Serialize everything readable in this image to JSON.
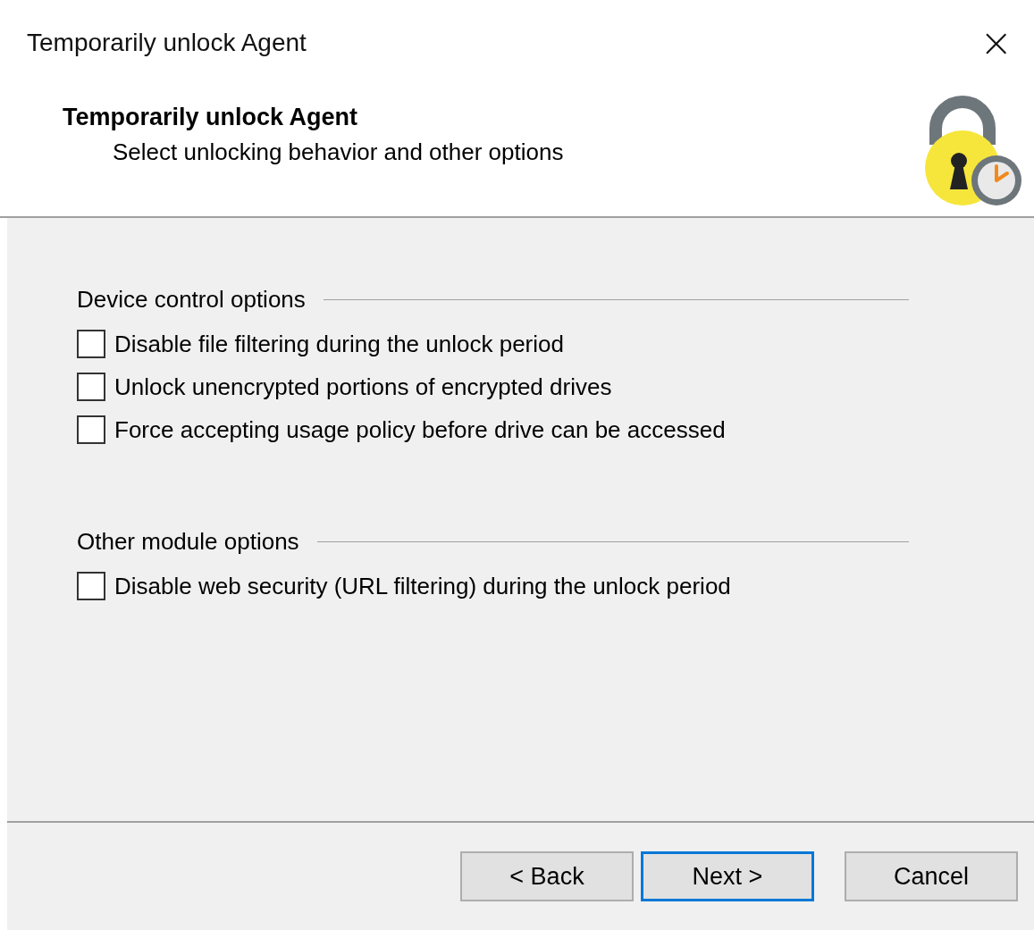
{
  "window": {
    "title": "Temporarily unlock Agent",
    "close": "×"
  },
  "header": {
    "title": "Temporarily unlock Agent",
    "subtitle": "Select unlocking behavior and other options"
  },
  "groups": [
    {
      "label": "Device control options",
      "options": [
        {
          "label": "Disable file filtering during the unlock period",
          "checked": false
        },
        {
          "label": "Unlock unencrypted portions of encrypted drives",
          "checked": false
        },
        {
          "label": "Force accepting usage policy before drive can be accessed",
          "checked": false
        }
      ]
    },
    {
      "label": "Other module options",
      "options": [
        {
          "label": "Disable web security (URL filtering) during the unlock period",
          "checked": false
        }
      ]
    }
  ],
  "buttons": [
    {
      "label": "< Back",
      "default": false
    },
    {
      "label": "Next >",
      "default": true
    },
    {
      "label": "Cancel",
      "default": false
    }
  ]
}
